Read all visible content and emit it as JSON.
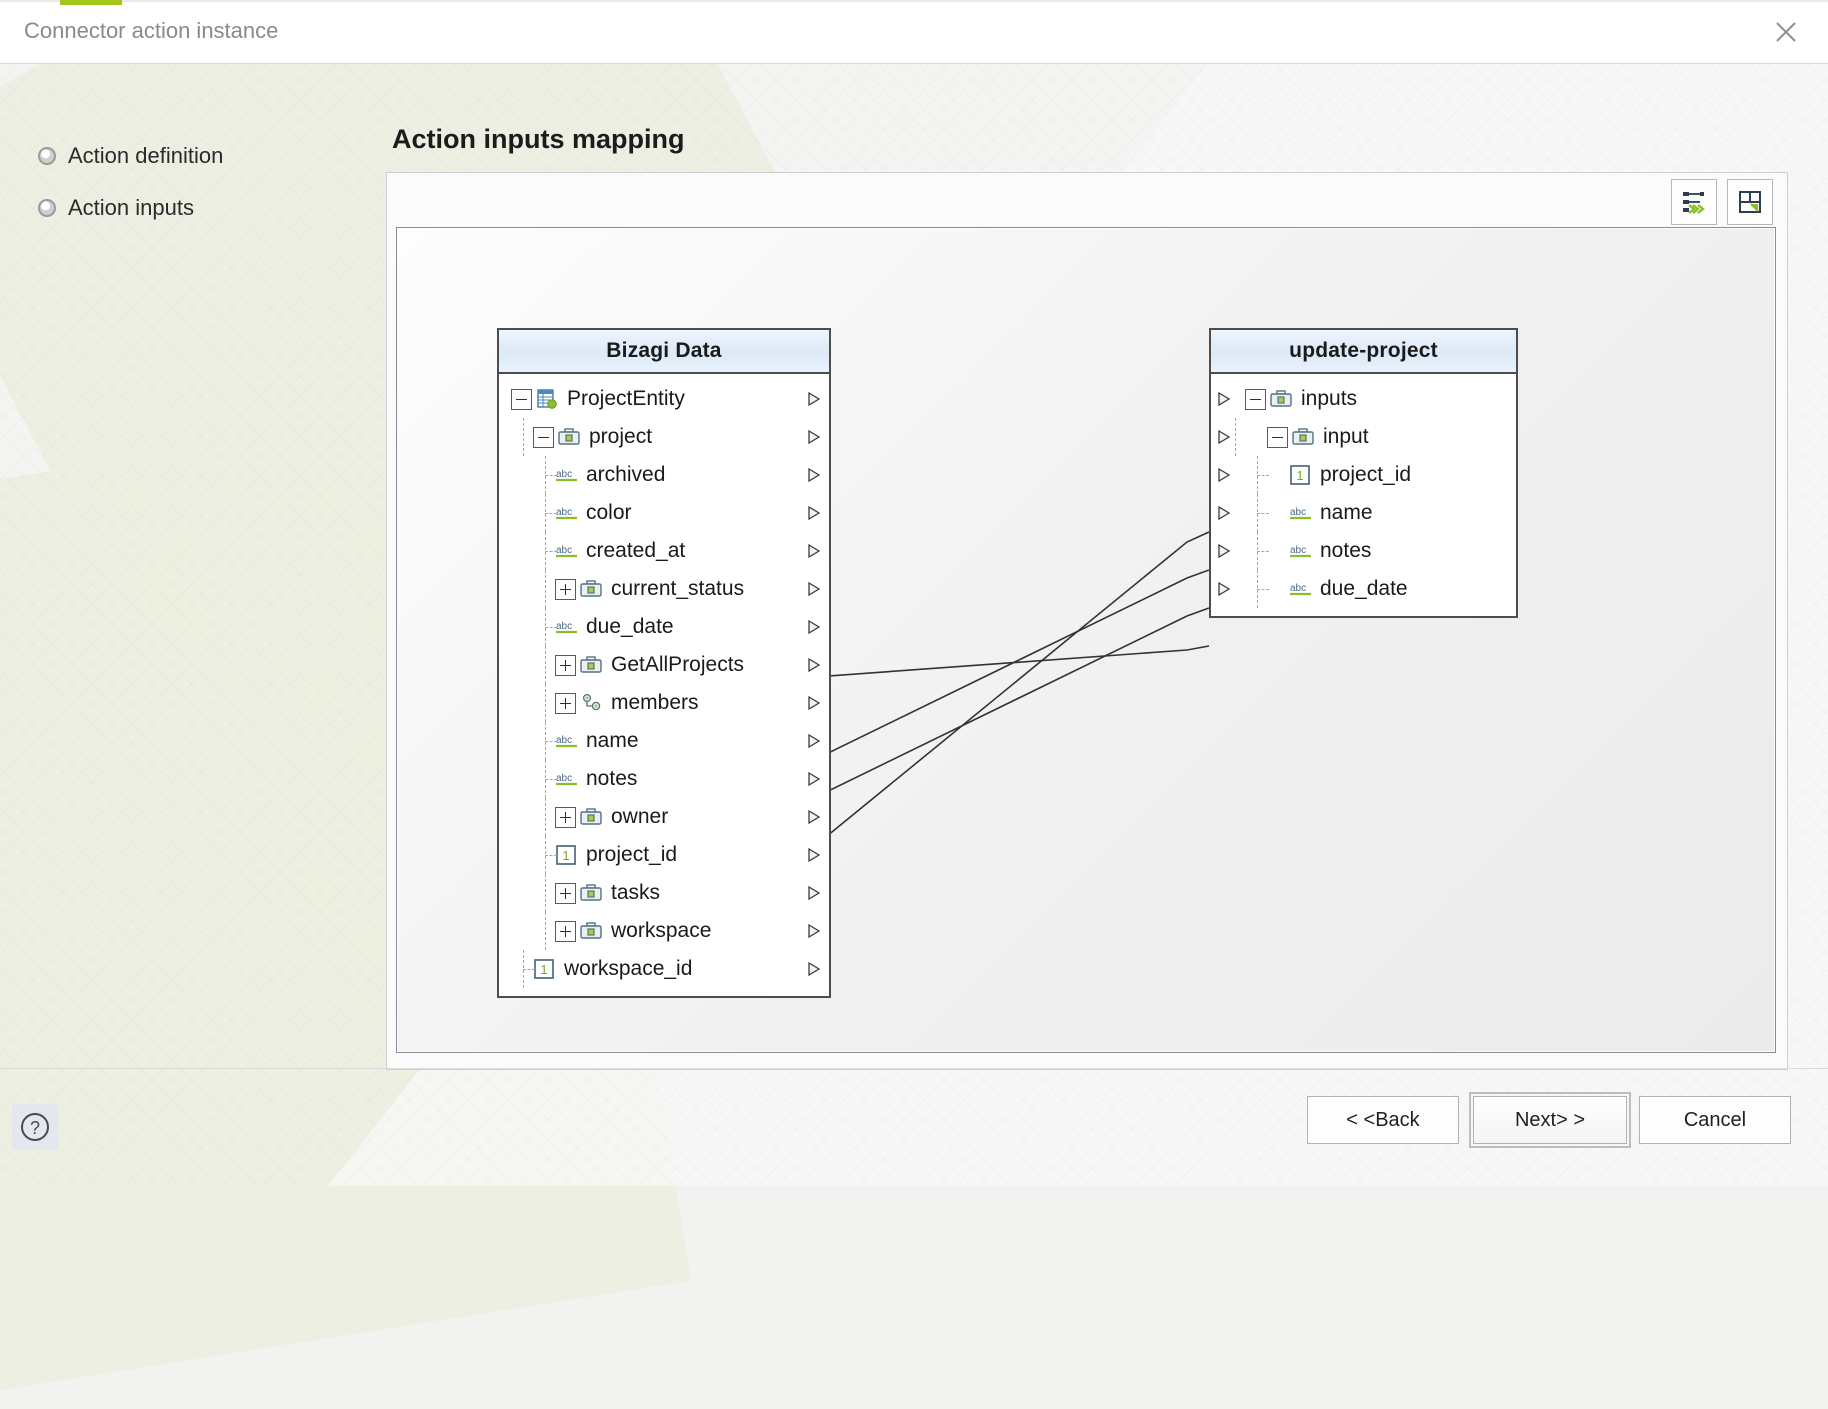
{
  "window": {
    "title": "Connector action instance",
    "close_icon": "close-icon"
  },
  "sidebar": {
    "items": [
      {
        "label": "Action definition",
        "icon": "radio-bullet-icon"
      },
      {
        "label": "Action inputs",
        "icon": "radio-bullet-icon"
      }
    ]
  },
  "main": {
    "page_title": "Action inputs mapping",
    "toolbar": [
      {
        "name": "auto-map-button",
        "icon": "auto-map-icon",
        "tooltip": "Auto map"
      },
      {
        "name": "fit-to-screen-button",
        "icon": "fit-screen-icon",
        "tooltip": "Fit to screen"
      }
    ]
  },
  "source_panel": {
    "title": "Bizagi Data",
    "rows": [
      {
        "label": "ProjectEntity",
        "icon": "entity-table-icon",
        "expander": "minus",
        "depth": 0,
        "has_port": true
      },
      {
        "label": "project",
        "icon": "object-case-icon",
        "expander": "minus",
        "depth": 1,
        "has_port": true
      },
      {
        "label": "archived",
        "icon": "abc-text-icon",
        "expander": "none",
        "depth": 2,
        "has_port": true
      },
      {
        "label": "color",
        "icon": "abc-text-icon",
        "expander": "none",
        "depth": 2,
        "has_port": true
      },
      {
        "label": "created_at",
        "icon": "abc-text-icon",
        "expander": "none",
        "depth": 2,
        "has_port": true
      },
      {
        "label": "current_status",
        "icon": "object-case-icon",
        "expander": "plus",
        "depth": 2,
        "has_port": true
      },
      {
        "label": "due_date",
        "icon": "abc-text-icon",
        "expander": "none",
        "depth": 2,
        "has_port": true
      },
      {
        "label": "GetAllProjects",
        "icon": "object-case-icon",
        "expander": "plus",
        "depth": 2,
        "has_port": true
      },
      {
        "label": "members",
        "icon": "collection-icon",
        "expander": "plus",
        "depth": 2,
        "has_port": true
      },
      {
        "label": "name",
        "icon": "abc-text-icon",
        "expander": "none",
        "depth": 2,
        "has_port": true
      },
      {
        "label": "notes",
        "icon": "abc-text-icon",
        "expander": "none",
        "depth": 2,
        "has_port": true
      },
      {
        "label": "owner",
        "icon": "object-case-icon",
        "expander": "plus",
        "depth": 2,
        "has_port": true
      },
      {
        "label": "project_id",
        "icon": "number-one-icon",
        "expander": "none",
        "depth": 2,
        "has_port": true
      },
      {
        "label": "tasks",
        "icon": "object-case-icon",
        "expander": "plus",
        "depth": 2,
        "has_port": true
      },
      {
        "label": "workspace",
        "icon": "object-case-icon",
        "expander": "plus",
        "depth": 2,
        "has_port": true
      },
      {
        "label": "workspace_id",
        "icon": "number-one-icon",
        "expander": "none",
        "depth": 1,
        "has_port": true
      }
    ]
  },
  "target_panel": {
    "title": "update-project",
    "rows": [
      {
        "label": "inputs",
        "icon": "object-case-icon",
        "expander": "minus",
        "depth": 0,
        "has_port": true
      },
      {
        "label": "input",
        "icon": "object-case-icon",
        "expander": "minus",
        "depth": 1,
        "has_port": true
      },
      {
        "label": "project_id",
        "icon": "number-one-icon",
        "expander": "none",
        "depth": 2,
        "has_port": true
      },
      {
        "label": "name",
        "icon": "abc-text-icon",
        "expander": "none",
        "depth": 2,
        "has_port": true
      },
      {
        "label": "notes",
        "icon": "abc-text-icon",
        "expander": "none",
        "depth": 2,
        "has_port": true
      },
      {
        "label": "due_date",
        "icon": "abc-text-icon",
        "expander": "none",
        "depth": 2,
        "has_port": true
      }
    ]
  },
  "mappings": [
    {
      "from": "due_date",
      "to": "due_date"
    },
    {
      "from": "name",
      "to": "name"
    },
    {
      "from": "notes",
      "to": "notes"
    },
    {
      "from": "project_id",
      "to": "project_id"
    }
  ],
  "footer": {
    "help_label": "?",
    "back_label": "< <Back",
    "next_label": "Next> >",
    "cancel_label": "Cancel"
  },
  "colors": {
    "accent_green": "#a3c61c",
    "panel_header_blue": "#dce9f8",
    "border_dark": "#4d4d4d",
    "title_grey": "#8a8a8a"
  }
}
